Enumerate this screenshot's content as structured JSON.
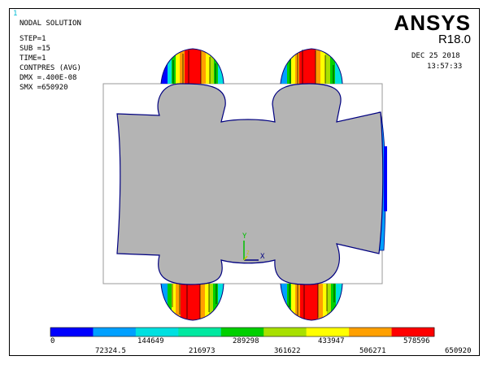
{
  "window_number": "1",
  "info": {
    "lines": [
      "NODAL SOLUTION",
      "STEP=1",
      "SUB =15",
      "TIME=1",
      "CONTPRES (AVG)",
      "DMX =.400E-08",
      "SMX =650920"
    ]
  },
  "brand": {
    "name": "ANSYS",
    "release": "R18.0"
  },
  "datestamp": {
    "date": "DEC 25 2018",
    "time": "13:57:33"
  },
  "triad": {
    "y": "Y",
    "x": "X",
    "z": "Z"
  },
  "legend": {
    "colors": [
      "#0000ff",
      "#00a0ff",
      "#00e0e0",
      "#00e8a0",
      "#00d000",
      "#a8e000",
      "#ffff00",
      "#ffa000",
      "#ff0000"
    ],
    "labels_top": [
      "0",
      "144649",
      "289298",
      "433947",
      "578596"
    ],
    "labels_bottom": [
      "72324.5",
      "216973",
      "361622",
      "506271",
      "650920"
    ]
  },
  "model": {
    "body_color": "#b4b4b4",
    "edge_color": "#000080",
    "box_color": "#808080"
  }
}
